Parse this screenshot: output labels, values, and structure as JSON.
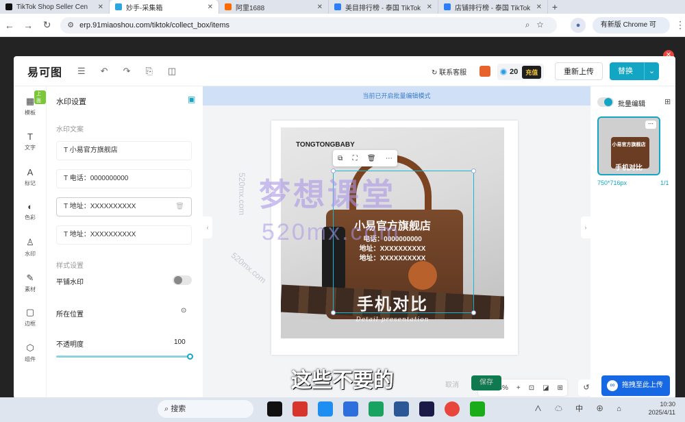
{
  "browser": {
    "tabs": [
      {
        "title": "TikTok Shop Seller Cen",
        "color": "#111111"
      },
      {
        "title": "妙手-采集箱",
        "color": "#2aa7e0"
      },
      {
        "title": "阿里1688",
        "color": "#ff6a00"
      },
      {
        "title": "美目排行榜 - 泰国 TikTok",
        "color": "#2d7ff9"
      },
      {
        "title": "店铺排行榜 - 泰国 TikTok",
        "color": "#2d7ff9"
      }
    ],
    "new_tab": "+",
    "url": "erp.91miaoshou.com/tiktok/collect_box/items",
    "update_button": "有新版 Chrome 可用"
  },
  "editor": {
    "logo": "易可图",
    "customer_service": "联系客服",
    "credits": "20",
    "recharge": "充值",
    "reupload": "重新上传",
    "replace": "替换",
    "sidebar": [
      {
        "label": "模板",
        "icon": "▦"
      },
      {
        "label": "文字",
        "icon": "T"
      },
      {
        "label": "标记",
        "icon": "A"
      },
      {
        "label": "色彩",
        "icon": "◐"
      },
      {
        "label": "水印",
        "icon": "♙"
      },
      {
        "label": "素材",
        "icon": "✎"
      },
      {
        "label": "边框",
        "icon": "▢"
      },
      {
        "label": "组件",
        "icon": "⬡"
      }
    ],
    "sidebar_badge": "上面",
    "panel": {
      "title": "水印设置",
      "text_section": "水印文案",
      "fields": [
        "T 小易官方旗舰店",
        "T 电话：0000000000",
        "T 地址：XXXXXXXXXX",
        "T 地址：XXXXXXXXXX"
      ],
      "style_section": "样式设置",
      "tile": "平铺水印",
      "position": "所在位置",
      "opacity": "不透明度",
      "opacity_value": "100"
    },
    "batch_notice": "当前已开启批量编辑模式",
    "image": {
      "brand": "TONGTONGBABY",
      "shop": "小易官方旗舰店",
      "line1": "电话：0000000000",
      "line2": "地址：XXXXXXXXXX",
      "line3": "地址：XXXXXXXXXX",
      "title": "手机对比",
      "subtitle": "Detail presentation"
    },
    "zoom": "68%",
    "right": {
      "batch_edit": "批量编辑",
      "size": "750*716px",
      "page": "1/1"
    },
    "watermark_small": "520mx.com",
    "watermark_big": "梦想课堂",
    "watermark_big2": "520mx.com"
  },
  "footer": {
    "cancel": "取消",
    "save": "保存",
    "drag": "拖拽至此上传"
  },
  "subtitle": "这些不要的",
  "taskbar": {
    "search": "搜索",
    "tray": "∧ ☁ 中 ⊕ ⌂",
    "time": "10:30",
    "date": "2025/4/11"
  }
}
